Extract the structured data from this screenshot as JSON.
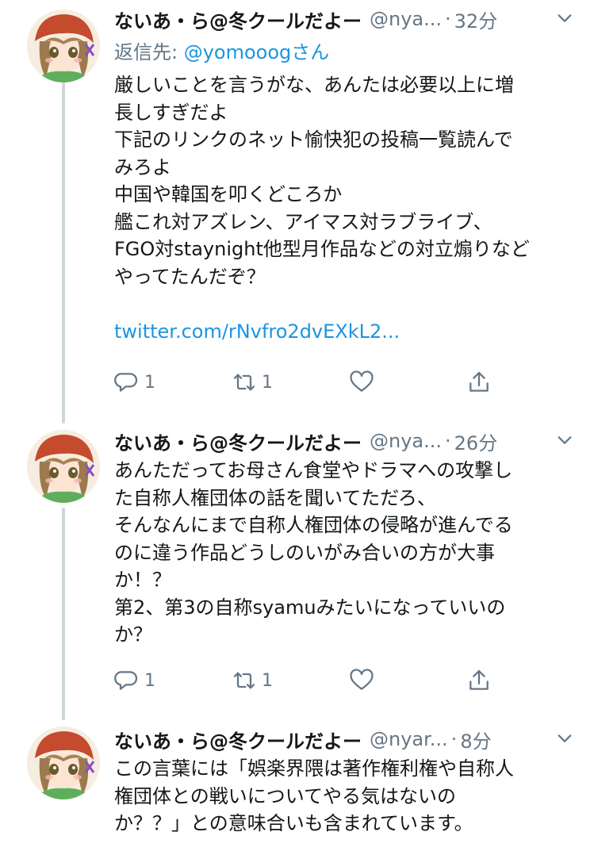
{
  "tweets": [
    {
      "name": "ないあ・ら@冬クールだよー",
      "handle": "@nya...",
      "dot": "·",
      "time": "32分",
      "reply_prefix": "返信先: ",
      "reply_mention": "@yomooog",
      "reply_suffix": "さん",
      "lines": [
        "厳しいことを言うがな、あんたは必要以上に増",
        "長しすぎだよ",
        "下記のリンクのネット愉快犯の投稿一覧読んで",
        "みろよ",
        "中国や韓国を叩くどころか",
        "艦これ対アズレン、アイマス対ラブライブ、",
        "FGO対staynight他型月作品などの対立煽りなど",
        "やってたんだぞ？"
      ],
      "link": "twitter.com/rNvfro2dvEXkL2...",
      "reply_count": "1",
      "retweet_count": "1"
    },
    {
      "name": "ないあ・ら@冬クールだよー",
      "handle": "@nya...",
      "dot": "·",
      "time": "26分",
      "lines": [
        "あんただってお母さん食堂やドラマへの攻撃し",
        "た自称人権団体の話を聞いてただろ、",
        "そんなんにまで自称人権団体の侵略が進んでる",
        "のに違う作品どうしのいがみ合いの方が大事",
        "か！？",
        "第2、第3の自称syamuみたいになっていいの",
        "か？"
      ],
      "reply_count": "1",
      "retweet_count": "1"
    },
    {
      "name": "ないあ・ら@冬クールだよー",
      "handle": "@nyar...",
      "dot": "·",
      "time": "8分",
      "lines": [
        "この言葉には「娯楽界隈は著作権利権や自称人",
        "権団体との戦いについてやる気はないの",
        "か？？」との意味合いも含まれています。"
      ]
    }
  ],
  "icons": {
    "reply": "reply-icon",
    "retweet": "retweet-icon",
    "like": "heart-icon",
    "share": "share-icon",
    "menu": "chevron-down-icon"
  },
  "colors": {
    "text": "#14171a",
    "secondary": "#657786",
    "link": "#1b95e0",
    "thread_line": "#ccd6dd"
  }
}
